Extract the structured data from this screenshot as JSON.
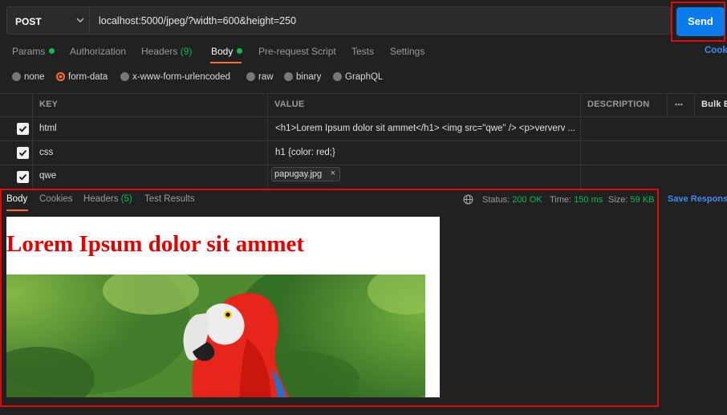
{
  "request": {
    "method": "POST",
    "url": "localhost:5000/jpeg/?width=600&height=250",
    "send_label": "Send"
  },
  "tabs": {
    "params": "Params",
    "authorization": "Authorization",
    "headers": "Headers",
    "headers_count": "(9)",
    "body": "Body",
    "prerequest": "Pre-request Script",
    "tests": "Tests",
    "settings": "Settings",
    "cookies": "Cook"
  },
  "body_types": {
    "none": "none",
    "form_data": "form-data",
    "urlencoded": "x-www-form-urlencoded",
    "raw": "raw",
    "binary": "binary",
    "graphql": "GraphQL"
  },
  "table": {
    "headers": {
      "key": "KEY",
      "value": "VALUE",
      "description": "DESCRIPTION",
      "more": "•••",
      "bulk_edit": "Bulk E"
    },
    "rows": [
      {
        "key": "html",
        "value": "<h1>Lorem Ipsum dolor sit ammet</h1> <img src=\"qwe\" /> <p>ververv ..."
      },
      {
        "key": "css",
        "value": "h1 {color: red;}"
      },
      {
        "key": "qwe",
        "file": "papugay.jpg",
        "remove": "×"
      }
    ]
  },
  "response": {
    "tabs": {
      "body": "Body",
      "cookies": "Cookies",
      "headers": "Headers",
      "headers_count": "(5)",
      "test_results": "Test Results"
    },
    "status_label": "Status:",
    "status_value": "200 OK",
    "time_label": "Time:",
    "time_value": "150 ms",
    "size_label": "Size:",
    "size_value": "59 KB",
    "save_label": "Save Respons",
    "preview_heading": "Lorem Ipsum dolor sit ammet"
  },
  "colors": {
    "accent_orange": "#ff6c37",
    "send_blue": "#097bed",
    "status_green": "#0cbb52",
    "highlight_red": "#e00b0b"
  }
}
